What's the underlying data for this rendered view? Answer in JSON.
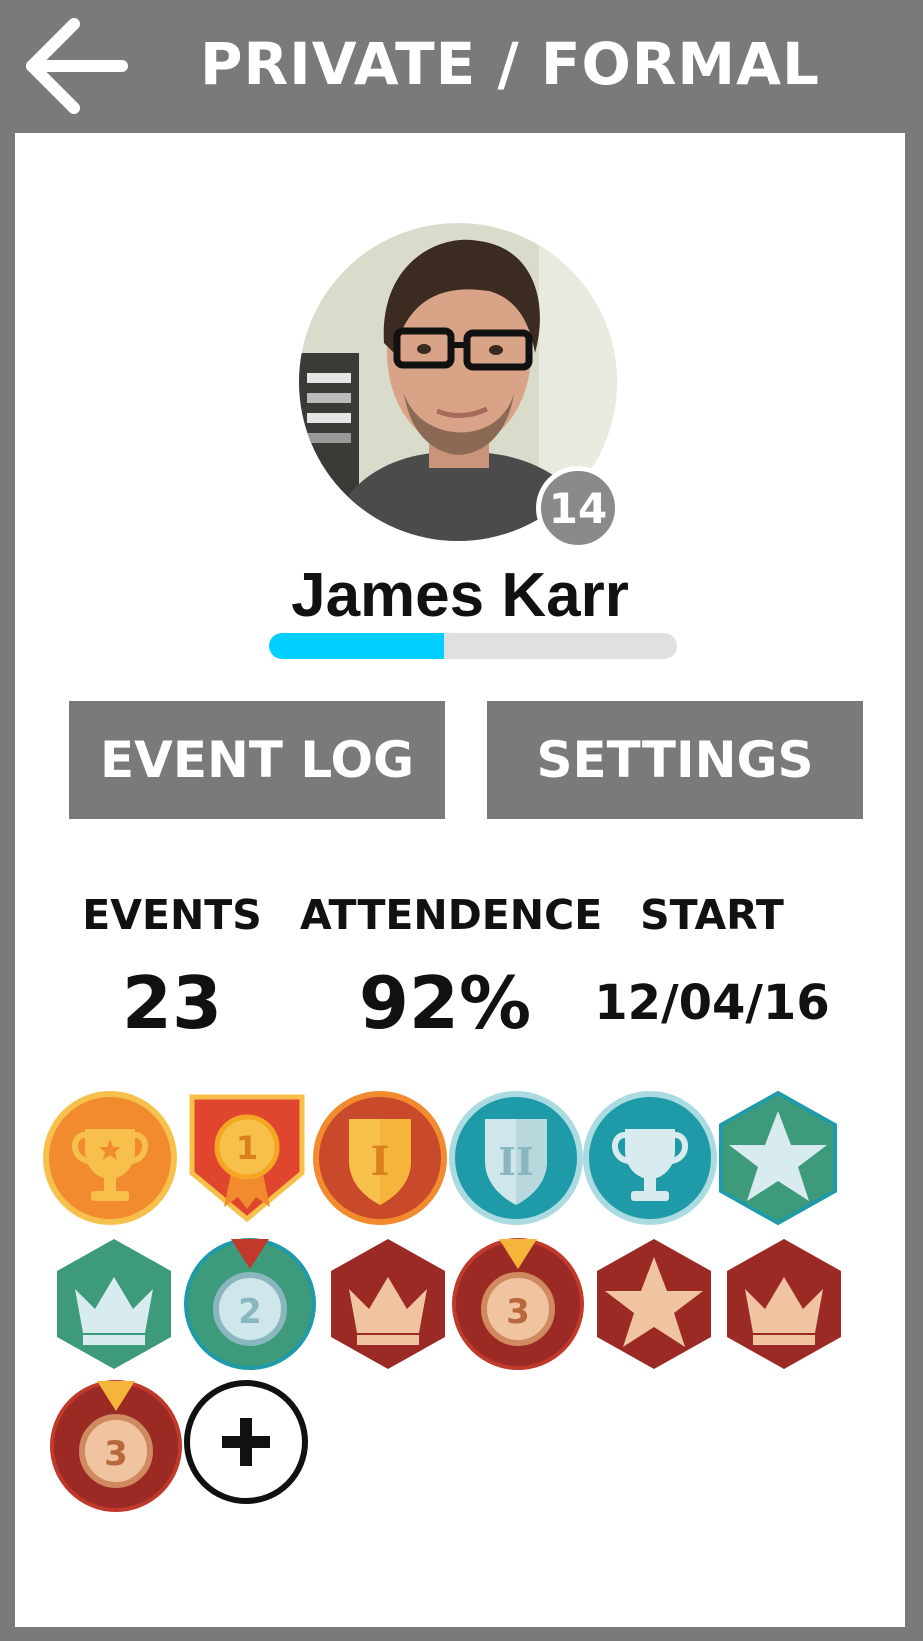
{
  "header": {
    "title": "PRIVATE / FORMAL",
    "back_icon": "arrow-left-icon"
  },
  "profile": {
    "name": "James Karr",
    "level": "14",
    "xp_progress": 0.43
  },
  "buttons": {
    "event_log": "EVENT LOG",
    "settings": "SETTINGS"
  },
  "stats": [
    {
      "label": "EVENTS",
      "value": "23"
    },
    {
      "label": "ATTENDENCE",
      "value": "92%"
    },
    {
      "label": "START",
      "value": "12/04/16"
    }
  ],
  "badges": [
    {
      "icon": "gold-trophy-icon",
      "digit": ""
    },
    {
      "icon": "gold-medal-ribbon-icon",
      "digit": "1"
    },
    {
      "icon": "gold-shield-icon",
      "digit": "I"
    },
    {
      "icon": "silver-shield-icon",
      "digit": "II"
    },
    {
      "icon": "silver-trophy-icon",
      "digit": ""
    },
    {
      "icon": "teal-star-icon",
      "digit": ""
    },
    {
      "icon": "silver-crown-icon",
      "digit": ""
    },
    {
      "icon": "silver-medal-icon",
      "digit": "2"
    },
    {
      "icon": "bronze-crown-icon",
      "digit": ""
    },
    {
      "icon": "bronze-medal-icon",
      "digit": "3"
    },
    {
      "icon": "bronze-star-icon",
      "digit": ""
    },
    {
      "icon": "bronze-crown-icon",
      "digit": ""
    },
    {
      "icon": "bronze-medal-icon",
      "digit": "3"
    }
  ],
  "add_badge_icon": "plus-circle-icon",
  "colors": {
    "chrome": "#7a7a7a",
    "progress": "#00cfff",
    "gold_bg": "#f28a2e",
    "red_bg": "#c0392b",
    "teal_bg": "#1f9aa8",
    "green_bg": "#3d9a7a",
    "maroon_bg": "#9b2a24"
  }
}
